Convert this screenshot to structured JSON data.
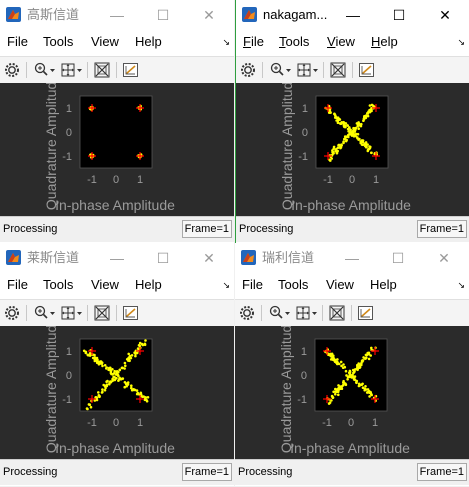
{
  "windows": [
    {
      "title": "高斯信道",
      "active": false,
      "menus": [
        "File",
        "Tools",
        "View",
        "Help"
      ],
      "status": "Processing",
      "frame": "Frame=1",
      "xlabel": "In-phase Amplitude",
      "ylabel": "Quadrature Amplitude",
      "xticks": [
        "-1",
        "0",
        "1"
      ],
      "yticks": [
        "1",
        "0",
        "-1"
      ],
      "pattern": "clusters"
    },
    {
      "title": "nakagam...",
      "active": true,
      "menus": [
        "File",
        "Tools",
        "View",
        "Help"
      ],
      "status": "Processing",
      "frame": "Frame=1",
      "xlabel": "In-phase Amplitude",
      "ylabel": "Quadrature Amplitude",
      "xticks": [
        "-1",
        "0",
        "1"
      ],
      "yticks": [
        "1",
        "0",
        "-1"
      ],
      "pattern": "cross"
    },
    {
      "title": "莱斯信道",
      "active": false,
      "menus": [
        "File",
        "Tools",
        "View",
        "Help"
      ],
      "status": "Processing",
      "frame": "Frame=1",
      "xlabel": "In-phase Amplitude",
      "ylabel": "Quadrature Amplitude",
      "xticks": [
        "-1",
        "0",
        "1"
      ],
      "yticks": [
        "1",
        "0",
        "-1"
      ],
      "pattern": "cross-wide"
    },
    {
      "title": "瑞利信道",
      "active": false,
      "menus": [
        "File",
        "Tools",
        "View",
        "Help"
      ],
      "status": "Processing",
      "frame": "Frame=1",
      "xlabel": "In-phase Amplitude",
      "ylabel": "Quadrature Amplitude",
      "xticks": [
        "-1",
        "0",
        "1"
      ],
      "yticks": [
        "1",
        "0",
        "-1"
      ],
      "pattern": "cross"
    }
  ],
  "icons": {
    "app": "matlab-icon",
    "minimize": "minimize-icon",
    "maximize": "maximize-icon",
    "close": "close-icon",
    "settings": "gear-icon",
    "zoom": "zoom-in-icon",
    "pan": "pan-icon",
    "autoscale": "autoscale-icon",
    "style": "style-icon"
  },
  "colors": {
    "plot_bg": "#2b2b2b",
    "axes_bg": "#000000",
    "points": "#ffff00",
    "reference": "#ff0000",
    "labels": "#9a9a9a"
  },
  "glyphs": {
    "minimize": "—",
    "maximize": "☐",
    "close": "✕",
    "menu_arrow": "↘"
  }
}
